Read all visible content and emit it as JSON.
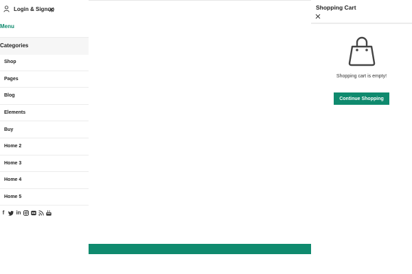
{
  "mobile_menu": {
    "login_label": "Login & Signup",
    "menu_tab": "Menu",
    "categories_label": "Categories",
    "items": [
      {
        "label": "Shop"
      },
      {
        "label": "Pages"
      },
      {
        "label": "Blog"
      },
      {
        "label": "Elements"
      },
      {
        "label": "Buy"
      },
      {
        "label": "Home 2"
      },
      {
        "label": "Home 3"
      },
      {
        "label": "Home 4"
      },
      {
        "label": "Home 5"
      }
    ],
    "social": [
      {
        "icon": "facebook-icon",
        "glyph": "f"
      },
      {
        "icon": "twitter-icon"
      },
      {
        "icon": "linkedin-icon",
        "glyph": "in"
      },
      {
        "icon": "instagram-icon"
      },
      {
        "icon": "flickr-icon"
      },
      {
        "icon": "rss-icon"
      },
      {
        "icon": "youtube-icon"
      }
    ]
  },
  "cart": {
    "title": "Shopping Cart",
    "empty_message": "Shopping cart is empty!",
    "continue_label": "Continue Shopping"
  },
  "colors": {
    "accent": "#0f8a6e",
    "divider": "#ececec",
    "panel_header_bg": "#f6f6f6"
  }
}
